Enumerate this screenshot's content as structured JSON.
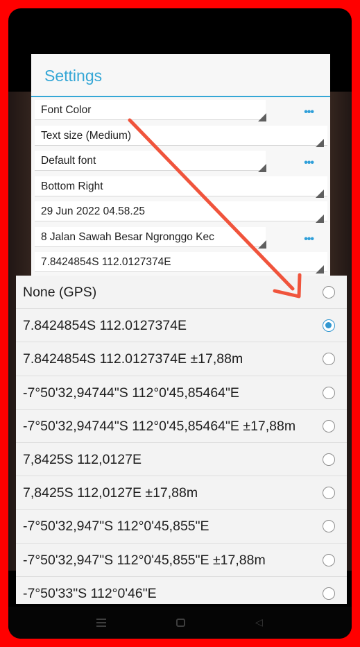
{
  "settings": {
    "title": "Settings",
    "rows": [
      {
        "label": "Font Color",
        "has_more": true
      },
      {
        "label": "Text size (Medium)",
        "has_more": false
      },
      {
        "label": "Default font",
        "has_more": true
      },
      {
        "label": "Bottom Right",
        "has_more": false
      },
      {
        "label": "29 Jun 2022 04.58.25",
        "has_more": false
      },
      {
        "label": "8 Jalan Sawah Besar Ngronggo Kec",
        "has_more": true
      },
      {
        "label": "7.8424854S 112.0127374E",
        "has_more": false
      }
    ],
    "more_glyph": "•••"
  },
  "coordinate_format_options": {
    "selected_index": 1,
    "items": [
      {
        "label": "None (GPS)",
        "selected": false
      },
      {
        "label": "7.8424854S 112.0127374E",
        "selected": true
      },
      {
        "label": "7.8424854S 112.0127374E ±17,88m",
        "selected": false
      },
      {
        "label": "-7°50'32,94744\"S 112°0'45,85464\"E",
        "selected": false
      },
      {
        "label": "-7°50'32,94744\"S 112°0'45,85464\"E ±17,88m",
        "selected": false
      },
      {
        "label": "7,8425S 112,0127E",
        "selected": false
      },
      {
        "label": "7,8425S 112,0127E ±17,88m",
        "selected": false
      },
      {
        "label": "-7°50'32,947\"S 112°0'45,855\"E",
        "selected": false
      },
      {
        "label": "-7°50'32,947\"S 112°0'45,855\"E ±17,88m",
        "selected": false
      },
      {
        "label": "-7°50'33\"S 112°0'46\"E",
        "selected": false
      }
    ]
  },
  "navbar": {
    "icons": [
      "menu-icon",
      "home-icon",
      "back-icon"
    ]
  },
  "colors": {
    "accent": "#35a7d6",
    "radio_selected": "#3197d0",
    "annotation_arrow": "#f0543c",
    "frame_border": "#ff0000"
  }
}
